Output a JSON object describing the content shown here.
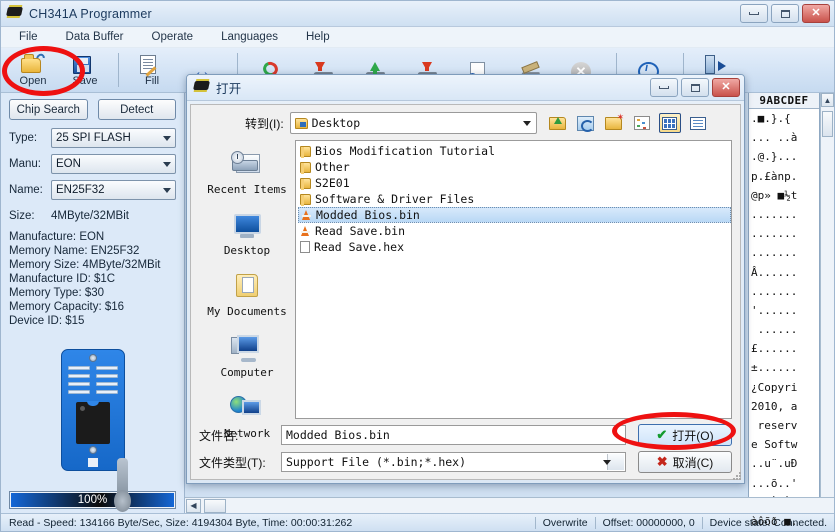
{
  "window": {
    "title": "CH341A Programmer",
    "icon": "chip-icon",
    "buttons": {
      "minimize": "minimize-icon",
      "maximize": "maximize-icon",
      "close": "close-icon"
    }
  },
  "menubar": {
    "items": [
      {
        "label": "File"
      },
      {
        "label": "Data Buffer"
      },
      {
        "label": "Operate"
      },
      {
        "label": "Languages"
      },
      {
        "label": "Help"
      }
    ]
  },
  "toolbar": {
    "buttons": [
      {
        "label": "Open",
        "icon": "open-folder-icon"
      },
      {
        "label": "Save",
        "icon": "floppy-disk-icon"
      },
      {
        "label": "Fill",
        "icon": "edit-page-icon"
      },
      {
        "label": "",
        "icon": "double-arrow-icon"
      },
      {
        "label": "",
        "icon": "erase-chip-icon"
      },
      {
        "label": "",
        "icon": "read-chip-icon"
      },
      {
        "label": "",
        "icon": "write-chip-icon"
      },
      {
        "label": "",
        "icon": "verify-chip-icon"
      },
      {
        "label": "",
        "icon": "blank-check-icon"
      },
      {
        "label": "",
        "icon": "cancel-icon"
      },
      {
        "label": "",
        "icon": "info-icon"
      },
      {
        "label": "Exit",
        "icon": "exit-door-icon"
      }
    ]
  },
  "sidebar": {
    "chip_search_label": "Chip Search",
    "detect_label": "Detect",
    "fields": [
      {
        "label": "Type:",
        "value": "25 SPI FLASH"
      },
      {
        "label": "Manu:",
        "value": "EON"
      },
      {
        "label": "Name:",
        "value": "EN25F32"
      }
    ],
    "size_label": "Size:",
    "size_value": "4MByte/32MBit",
    "info_lines": [
      "Manufacture: EON",
      "Memory Name: EN25F32",
      "Memory Size: 4MByte/32MBit",
      "Manufacture ID: $1C",
      "Memory Type: $30",
      "Memory Capacity: $16",
      "Device ID: $15"
    ],
    "progress": "100%"
  },
  "hexview": {
    "header": "9ABCDEF",
    "ascii_rows": [
      ".■.}.{",
      "... ..à",
      ".@.}...",
      "p.£ànp.",
      "@p» ■½t",
      ".......",
      ".......",
      ".......",
      "Â......",
      ".......",
      "'......",
      " ......",
      "£......",
      "±......",
      "¿Copyri",
      "2010, a",
      " reserv",
      "e Softw",
      "..u¨.uÐ",
      "...õ..'",
      "...ÀÐÀà",
      "àôõð ■."
    ]
  },
  "statusbar": {
    "message": "Read - Speed: 134166 Byte/Sec, Size: 4194304 Byte, Time: 00:00:31:262",
    "mode": "Overwrite",
    "offset": "Offset: 00000000, 0",
    "device_state": "Device state: Connected."
  },
  "dialog": {
    "title": "打开",
    "icon": "chip-icon",
    "buttons": {
      "minimize": "minimize-icon",
      "maximize": "maximize-icon",
      "close": "close-icon"
    },
    "goto_label": "转到(I):",
    "goto_value": "Desktop",
    "toolbar_icons": [
      "up-folder-icon",
      "back-icon",
      "new-folder-icon",
      "list-view-icon",
      "tiles-view-icon",
      "details-view-icon"
    ],
    "places": [
      {
        "label": "Recent Items",
        "icon": "recent-items-icon"
      },
      {
        "label": "Desktop",
        "icon": "desktop-icon"
      },
      {
        "label": "My Documents",
        "icon": "my-documents-icon"
      },
      {
        "label": "Computer",
        "icon": "computer-icon"
      },
      {
        "label": "Network",
        "icon": "network-icon"
      }
    ],
    "files": [
      {
        "name": "Bios Modification Tutorial",
        "type": "folder",
        "selected": false
      },
      {
        "name": "Other",
        "type": "folder",
        "selected": false
      },
      {
        "name": "S2E01",
        "type": "folder",
        "selected": false
      },
      {
        "name": "Software & Driver Files",
        "type": "folder",
        "selected": false
      },
      {
        "name": "Modded Bios.bin",
        "type": "bin",
        "selected": true
      },
      {
        "name": "Read Save.bin",
        "type": "bin",
        "selected": false
      },
      {
        "name": "Read Save.hex",
        "type": "doc",
        "selected": false
      }
    ],
    "filename_label": "文件名:",
    "filename_value": "Modded Bios.bin",
    "filetype_label": "文件类型(T):",
    "filetype_value": "Support File (*.bin;*.hex)",
    "open_button": "打开(O)",
    "cancel_button": "取消(C)"
  },
  "annotations": {
    "accent_color": "#ee1111",
    "highlighted": [
      "open-toolbar-button",
      "dialog-open-button"
    ]
  }
}
